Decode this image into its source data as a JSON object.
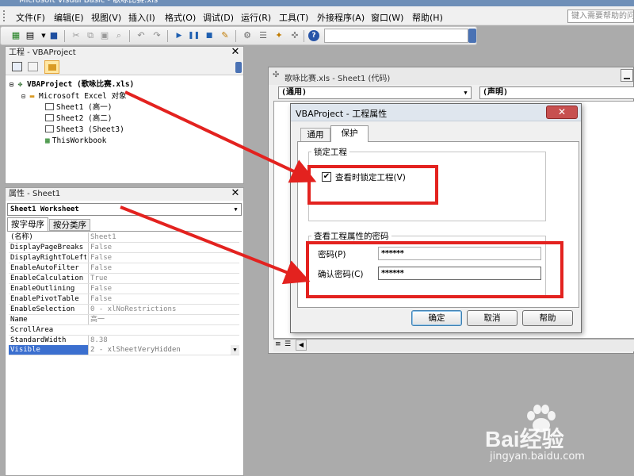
{
  "window": {
    "title": "Microsoft Visual Basic - 歌咏比赛.xls"
  },
  "menubar": {
    "items": [
      "文件(F)",
      "编辑(E)",
      "视图(V)",
      "插入(I)",
      "格式(O)",
      "调试(D)",
      "运行(R)",
      "工具(T)",
      "外接程序(A)",
      "窗口(W)",
      "帮助(H)"
    ],
    "help_placeholder": "键入需要帮助的问题"
  },
  "project_panel": {
    "title": "工程 - VBAProject",
    "tree": {
      "root": "VBAProject (歌咏比赛.xls)",
      "folder": "Microsoft Excel 对象",
      "sheets": [
        "Sheet1 (高一)",
        "Sheet2 (高二)",
        "Sheet3 (Sheet3)"
      ],
      "workbook": "ThisWorkbook"
    }
  },
  "properties_panel": {
    "title": "属性 - Sheet1",
    "object": "Sheet1 Worksheet",
    "tabs": [
      "按字母序",
      "按分类序"
    ],
    "rows": [
      {
        "name": "(名称)",
        "value": "Sheet1"
      },
      {
        "name": "DisplayPageBreaks",
        "value": "False"
      },
      {
        "name": "DisplayRightToLeft",
        "value": "False"
      },
      {
        "name": "EnableAutoFilter",
        "value": "False"
      },
      {
        "name": "EnableCalculation",
        "value": "True"
      },
      {
        "name": "EnableOutlining",
        "value": "False"
      },
      {
        "name": "EnablePivotTable",
        "value": "False"
      },
      {
        "name": "EnableSelection",
        "value": "0 - xlNoRestrictions"
      },
      {
        "name": "Name",
        "value": "高一"
      },
      {
        "name": "ScrollArea",
        "value": ""
      },
      {
        "name": "StandardWidth",
        "value": "8.38"
      },
      {
        "name": "Visible",
        "value": "2 - xlSheetVeryHidden"
      }
    ]
  },
  "code_window": {
    "title": "歌咏比赛.xls - Sheet1 (代码)",
    "object_combo": "(通用)",
    "proc_combo": "(声明)"
  },
  "dialog": {
    "title": "VBAProject - 工程属性",
    "tabs": [
      "通用",
      "保护"
    ],
    "lock_group": "锁定工程",
    "lock_checkbox": "查看时锁定工程(V)",
    "lock_checked": true,
    "password_group": "查看工程属性的密码",
    "password_label": "密码(P)",
    "password_value": "******",
    "confirm_label": "确认密码(C)",
    "confirm_value": "******",
    "buttons": {
      "ok": "确定",
      "cancel": "取消",
      "help": "帮助"
    }
  },
  "watermark": {
    "text": "Bai经验",
    "url": "jingyan.baidu.com"
  },
  "annotation_colors": {
    "red": "#e3221f"
  }
}
